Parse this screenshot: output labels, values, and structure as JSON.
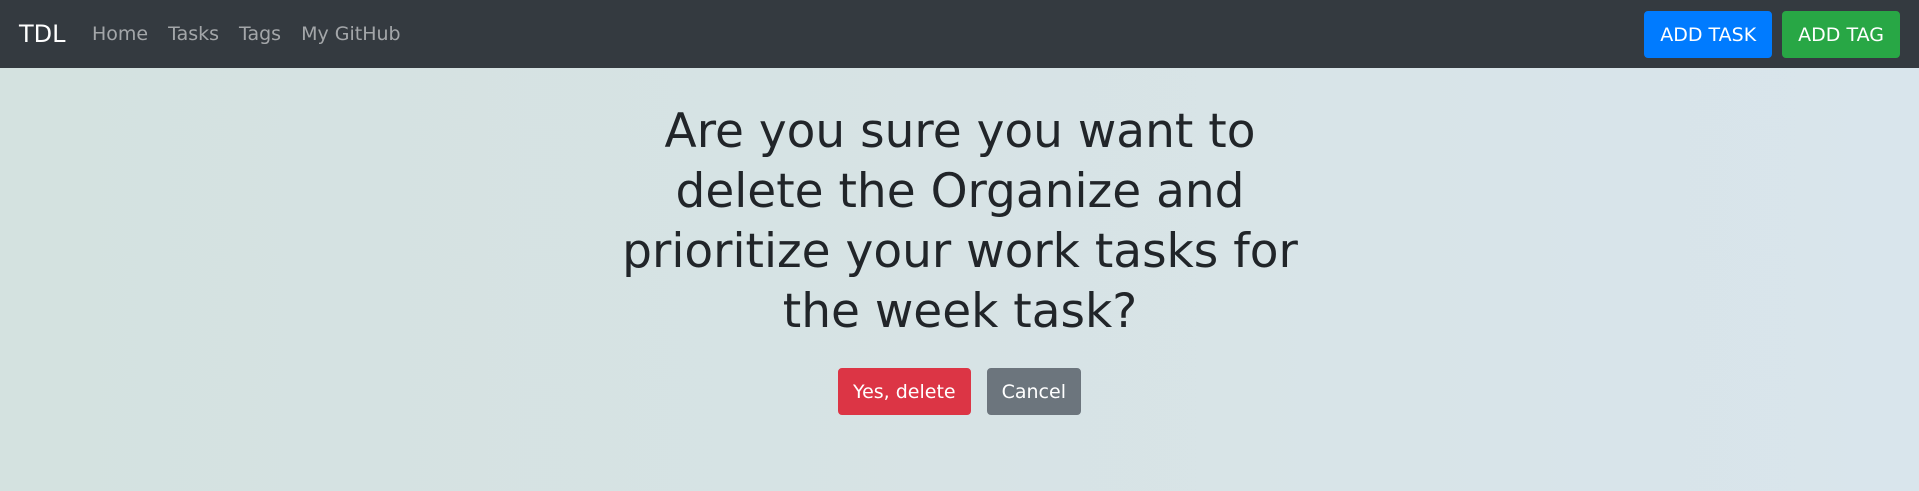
{
  "navbar": {
    "brand": "TDL",
    "links": [
      "Home",
      "Tasks",
      "Tags",
      "My GitHub"
    ],
    "add_task_label": "ADD TASK",
    "add_tag_label": "ADD TAG"
  },
  "dialog": {
    "question": "Are you sure you want to delete the Organize and prioritize your work tasks for the week task?",
    "confirm_label": "Yes, delete",
    "cancel_label": "Cancel"
  },
  "colors": {
    "navbar_bg": "#343a40",
    "primary": "#007bff",
    "success": "#28a745",
    "danger": "#dc3545",
    "secondary": "#6c757d"
  }
}
